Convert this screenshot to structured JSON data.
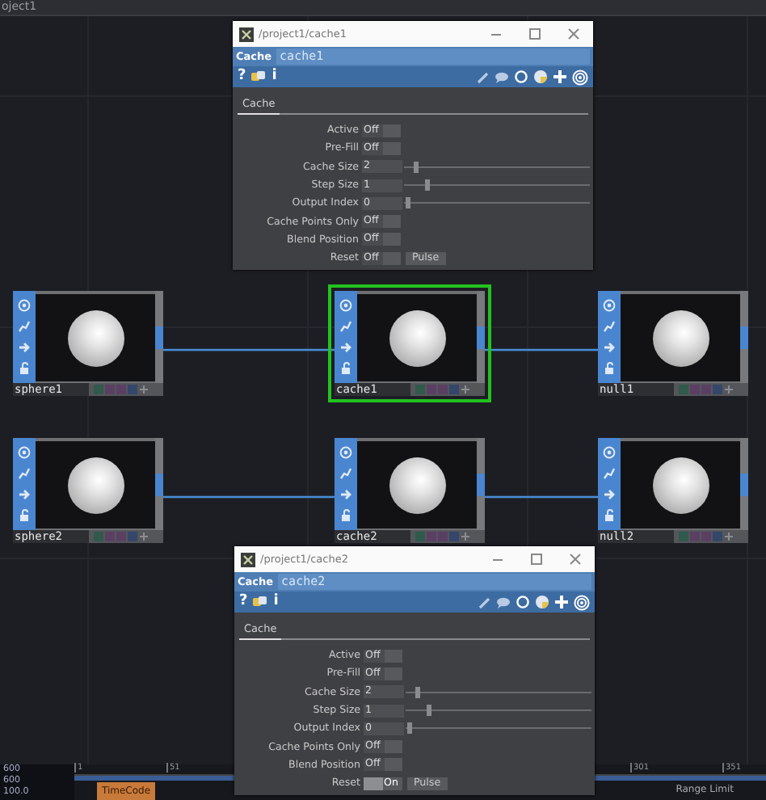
{
  "editor_title": "oject1",
  "nodes": [
    {
      "name": "sphere1",
      "selected": false
    },
    {
      "name": "cache1",
      "selected": true
    },
    {
      "name": "null1",
      "selected": false
    },
    {
      "name": "sphere2",
      "selected": false
    },
    {
      "name": "cache2",
      "selected": false
    },
    {
      "name": "null2",
      "selected": false
    }
  ],
  "param_windows": [
    {
      "title": "/project1/cache1",
      "op_type": "Cache",
      "op_name": "cache1",
      "help_glyph": "?",
      "info_glyph": "i",
      "page_tab": "Cache",
      "params": [
        {
          "kind": "toggle",
          "label": "Active",
          "value": "Off",
          "on": false
        },
        {
          "kind": "toggle",
          "label": "Pre-Fill",
          "value": "Off",
          "on": false
        },
        {
          "kind": "slider",
          "label": "Cache Size",
          "value": "2",
          "level": 0.05
        },
        {
          "kind": "slider",
          "label": "Step Size",
          "value": "1",
          "level": 0.11
        },
        {
          "kind": "slider",
          "label": "Output Index",
          "value": "0",
          "level": 0.01
        },
        {
          "kind": "toggle",
          "label": "Cache Points Only",
          "value": "Off",
          "on": false
        },
        {
          "kind": "toggle",
          "label": "Blend Position",
          "value": "Off",
          "on": false
        },
        {
          "kind": "pulse",
          "label": "Reset",
          "value": "Off",
          "on": false,
          "button": "Pulse"
        }
      ]
    },
    {
      "title": "/project1/cache2",
      "op_type": "Cache",
      "op_name": "cache2",
      "help_glyph": "?",
      "info_glyph": "i",
      "page_tab": "Cache",
      "params": [
        {
          "kind": "toggle",
          "label": "Active",
          "value": "Off",
          "on": false
        },
        {
          "kind": "toggle",
          "label": "Pre-Fill",
          "value": "Off",
          "on": false
        },
        {
          "kind": "slider",
          "label": "Cache Size",
          "value": "2",
          "level": 0.05
        },
        {
          "kind": "slider",
          "label": "Step Size",
          "value": "1",
          "level": 0.11
        },
        {
          "kind": "slider",
          "label": "Output Index",
          "value": "0",
          "level": 0.01
        },
        {
          "kind": "toggle",
          "label": "Cache Points Only",
          "value": "Off",
          "on": false
        },
        {
          "kind": "toggle",
          "label": "Blend Position",
          "value": "Off",
          "on": false
        },
        {
          "kind": "pulse",
          "label": "Reset",
          "value": "On",
          "on": true,
          "button": "Pulse"
        }
      ]
    }
  ],
  "timeline": {
    "readouts": [
      "600",
      "600",
      "100.0"
    ],
    "ruler_ticks": [
      "1",
      "51",
      "301",
      "351"
    ],
    "timecode_button": "TimeCode",
    "range_label": "Range Limit"
  }
}
